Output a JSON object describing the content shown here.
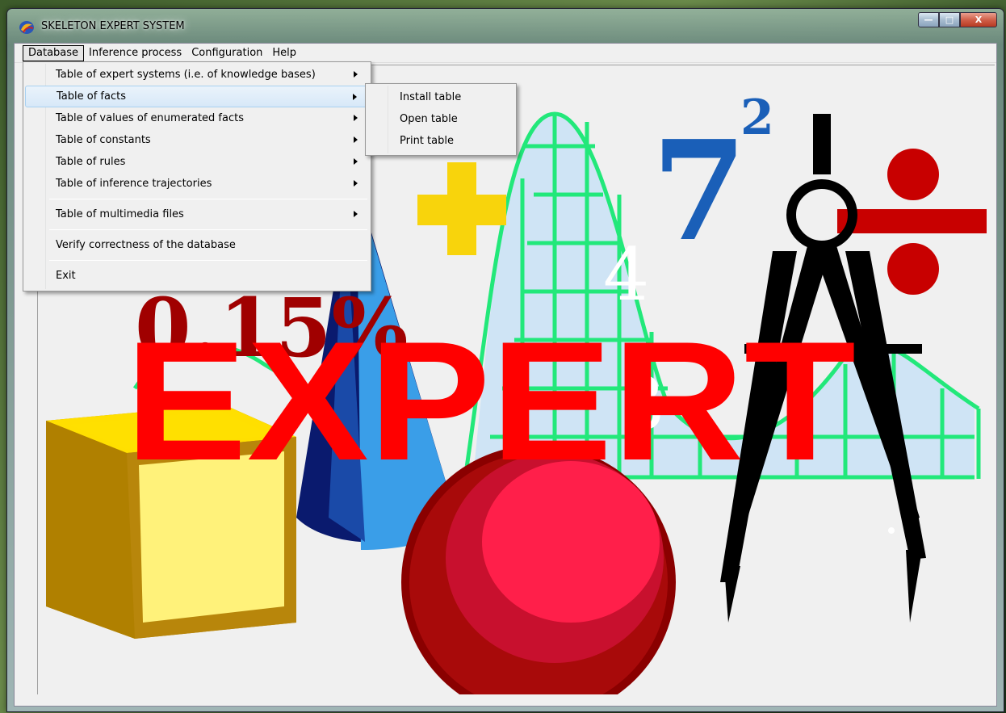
{
  "window": {
    "title": "SKELETON EXPERT SYSTEM",
    "min_symbol": "—",
    "max_symbol": "□",
    "close_symbol": "X"
  },
  "menubar": {
    "items": [
      {
        "label": "Database"
      },
      {
        "label": "Inference process"
      },
      {
        "label": "Configuration"
      },
      {
        "label": "Help"
      }
    ]
  },
  "database_menu": {
    "items": [
      {
        "label": "Table of expert systems (i.e. of knowledge bases)"
      },
      {
        "label": "Table of facts"
      },
      {
        "label": "Table of values of enumerated facts"
      },
      {
        "label": "Table of constants"
      },
      {
        "label": "Table of rules"
      },
      {
        "label": "Table of inference trajectories"
      },
      {
        "label": "Table of multimedia files"
      },
      {
        "label": "Verify correctness of the database"
      },
      {
        "label": "Exit"
      }
    ]
  },
  "facts_submenu": {
    "items": [
      {
        "label": "Install table"
      },
      {
        "label": "Open table"
      },
      {
        "label": "Print table"
      }
    ]
  },
  "splash": {
    "headline": "EXPERT",
    "headline_color": "#ff0000",
    "percent_text": "0.15%",
    "power_base": "7",
    "power_exponent": "2",
    "fraction_top": "4",
    "fraction_bottom": "3"
  }
}
